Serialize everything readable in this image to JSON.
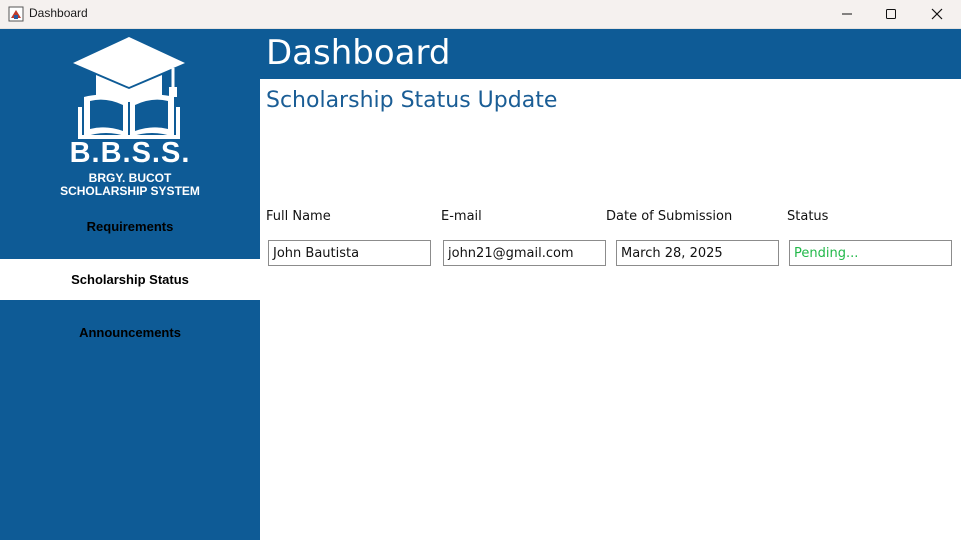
{
  "window": {
    "title": "Dashboard"
  },
  "sidebar": {
    "logo_title": "B.B.S.S.",
    "logo_subtitle_1": "BRGY. BUCOT",
    "logo_subtitle_2": "SCHOLARSHIP SYSTEM",
    "items": [
      {
        "label": "Requirements",
        "active": false
      },
      {
        "label": "Scholarship Status",
        "active": true
      },
      {
        "label": "Announcements",
        "active": false
      }
    ]
  },
  "header": {
    "title": "Dashboard"
  },
  "main": {
    "section_title": "Scholarship Status Update",
    "fields": {
      "full_name": {
        "label": "Full Name",
        "value": "John Bautista"
      },
      "email": {
        "label": "E-mail",
        "value": "john21@gmail.com"
      },
      "date": {
        "label": "Date of Submission",
        "value": "March 28, 2025"
      },
      "status": {
        "label": "Status",
        "value": "Pending..."
      }
    }
  },
  "colors": {
    "primary": "#0e5b96",
    "status_pending": "#22b84a",
    "section_title": "#1a5d95"
  },
  "icons": {
    "app": "app-icon",
    "minimize": "minimize-icon",
    "maximize": "maximize-icon",
    "close": "close-icon",
    "logo": "graduation-cap-book-logo"
  }
}
